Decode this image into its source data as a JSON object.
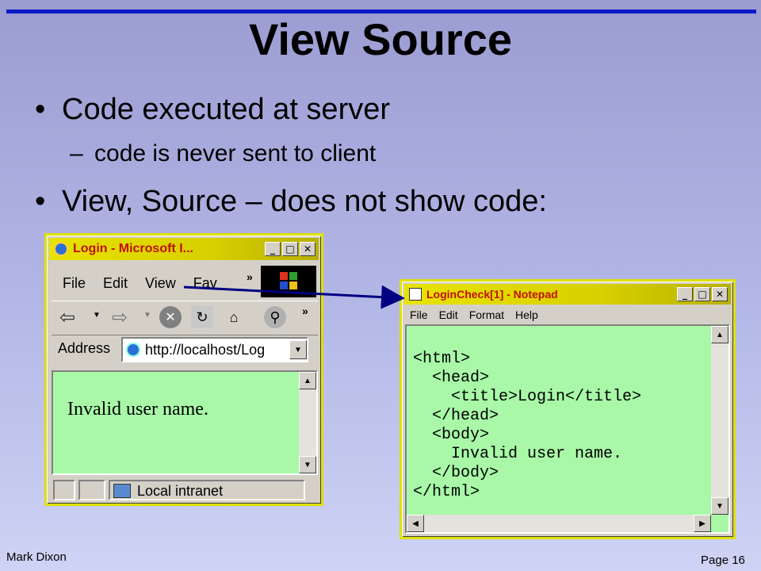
{
  "slide": {
    "title": "View Source",
    "bullet1": "Code executed at server",
    "sub1_dash": "–",
    "sub1": "code is never sent to client",
    "bullet2": "View, Source – does not show code:",
    "author": "Mark Dixon",
    "page": "Page 16"
  },
  "browser": {
    "title": "Login - Microsoft I...",
    "menu": [
      "File",
      "Edit",
      "View",
      "Fav"
    ],
    "address_label": "Address",
    "address_value": "http://localhost/Log",
    "content": "Invalid user name.",
    "status": "Local intranet"
  },
  "notepad": {
    "title": "LoginCheck[1] - Notepad",
    "menu": [
      "File",
      "Edit",
      "Format",
      "Help"
    ],
    "lines": [
      "<html>",
      "  <head>",
      "    <title>Login</title>",
      "  </head>",
      "  <body>",
      "    Invalid user name.",
      "  </body>",
      "</html>"
    ]
  },
  "colors": {
    "accent_bar": "#0a18c8",
    "titlebar_text": "#c01010",
    "content_bg": "#a8f8a8",
    "arrow": "#000080"
  }
}
